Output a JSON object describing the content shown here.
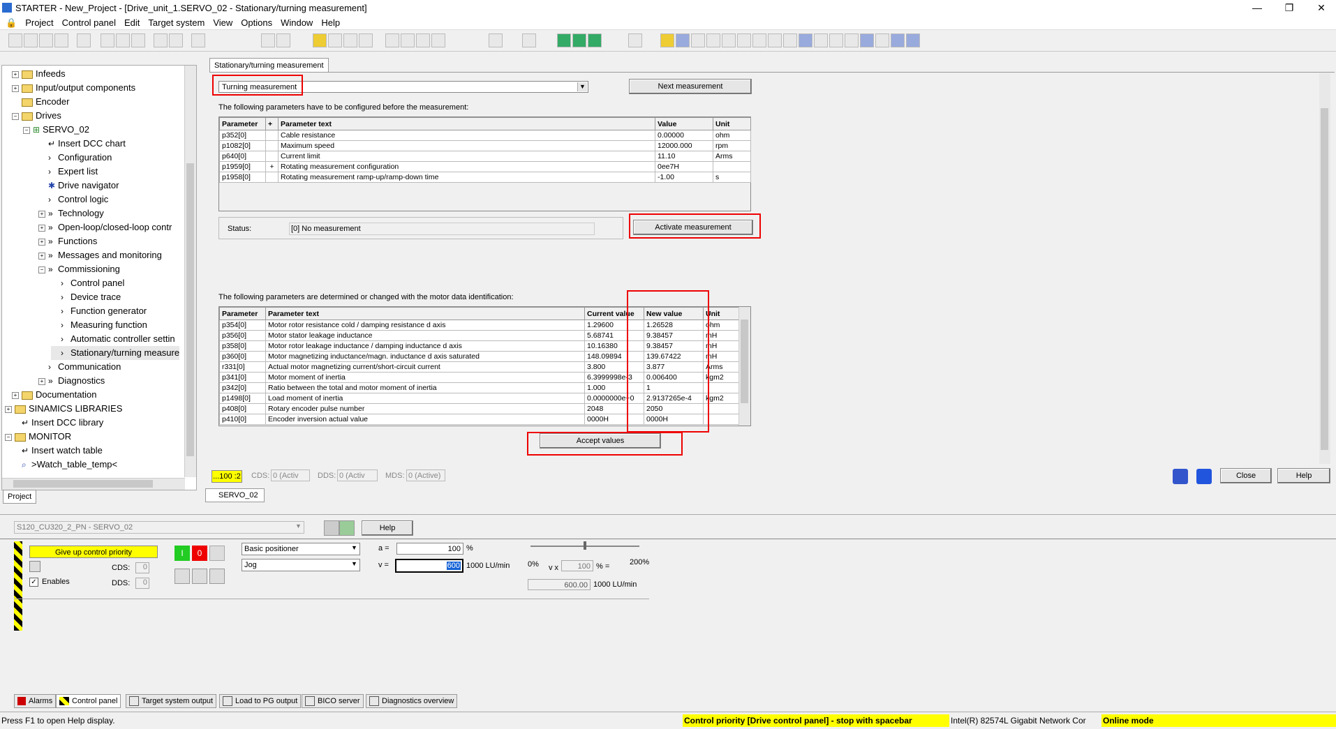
{
  "window": {
    "title": "STARTER - New_Project - [Drive_unit_1.SERVO_02 - Stationary/turning measurement]",
    "minimize": "—",
    "restore": "❐",
    "close": "✕"
  },
  "menu": [
    "Project",
    "Control panel",
    "Edit",
    "Target system",
    "View",
    "Options",
    "Window",
    "Help"
  ],
  "tree": {
    "items": [
      {
        "label": "Infeeds",
        "indent": 0,
        "type": "folder",
        "expand": "+"
      },
      {
        "label": "Input/output components",
        "indent": 0,
        "type": "folder",
        "expand": "+"
      },
      {
        "label": "Encoder",
        "indent": 0,
        "type": "folder",
        "expand": ""
      },
      {
        "label": "Drives",
        "indent": 0,
        "type": "folder",
        "expand": "-"
      },
      {
        "label": "SERVO_02",
        "indent": 1,
        "type": "drive",
        "expand": "-"
      },
      {
        "label": "Insert DCC chart",
        "indent": 2,
        "type": "item",
        "expand": ""
      },
      {
        "label": "Configuration",
        "indent": 2,
        "type": "chev",
        "expand": ""
      },
      {
        "label": "Expert list",
        "indent": 2,
        "type": "chev",
        "expand": ""
      },
      {
        "label": "Drive navigator",
        "indent": 2,
        "type": "gear",
        "expand": ""
      },
      {
        "label": "Control logic",
        "indent": 2,
        "type": "chev",
        "expand": ""
      },
      {
        "label": "Technology",
        "indent": 2,
        "type": "dchev",
        "expand": "+"
      },
      {
        "label": "Open-loop/closed-loop contr",
        "indent": 2,
        "type": "dchev",
        "expand": "+"
      },
      {
        "label": "Functions",
        "indent": 2,
        "type": "dchev",
        "expand": "+"
      },
      {
        "label": "Messages and monitoring",
        "indent": 2,
        "type": "dchev",
        "expand": "+"
      },
      {
        "label": "Commissioning",
        "indent": 2,
        "type": "dchev",
        "expand": "-"
      },
      {
        "label": "Control panel",
        "indent": 3,
        "type": "chev",
        "expand": ""
      },
      {
        "label": "Device trace",
        "indent": 3,
        "type": "chev",
        "expand": ""
      },
      {
        "label": "Function generator",
        "indent": 3,
        "type": "chev",
        "expand": ""
      },
      {
        "label": "Measuring function",
        "indent": 3,
        "type": "chev",
        "expand": ""
      },
      {
        "label": "Automatic controller settin",
        "indent": 3,
        "type": "chev",
        "expand": ""
      },
      {
        "label": "Stationary/turning measure",
        "indent": 3,
        "type": "chev",
        "expand": ""
      },
      {
        "label": "Communication",
        "indent": 2,
        "type": "chev",
        "expand": ""
      },
      {
        "label": "Diagnostics",
        "indent": 2,
        "type": "dchev",
        "expand": "+"
      },
      {
        "label": "Documentation",
        "indent": 0,
        "type": "folder",
        "expand": "+"
      },
      {
        "label": "SINAMICS LIBRARIES",
        "indent": -1,
        "type": "folder",
        "expand": "+"
      },
      {
        "label": "Insert DCC library",
        "indent": 0,
        "type": "item",
        "expand": ""
      },
      {
        "label": "MONITOR",
        "indent": -1,
        "type": "folder",
        "expand": "-"
      },
      {
        "label": "Insert watch table",
        "indent": 0,
        "type": "item",
        "expand": ""
      },
      {
        "label": ">Watch_table_temp<",
        "indent": 0,
        "type": "watch",
        "expand": ""
      }
    ],
    "tab": "Project"
  },
  "main": {
    "tab": "Stationary/turning measurement",
    "mode_select": "Turning measurement",
    "next_button": "Next measurement",
    "config_intro": "The following parameters have to be configured before the measurement:",
    "config_headers": [
      "Parameter",
      "+",
      "Parameter text",
      "Value",
      "Unit"
    ],
    "config_rows": [
      [
        "p352[0]",
        "",
        "Cable resistance",
        "0.00000",
        "ohm"
      ],
      [
        "p1082[0]",
        "",
        "Maximum speed",
        "12000.000",
        "rpm"
      ],
      [
        "p640[0]",
        "",
        "Current limit",
        "11.10",
        "Arms"
      ],
      [
        "p1959[0]",
        "+",
        "Rotating measurement configuration",
        "0ee7H",
        ""
      ],
      [
        "p1958[0]",
        "",
        "Rotating measurement ramp-up/ramp-down time",
        "-1.00",
        "s"
      ]
    ],
    "status_label": "Status:",
    "status_value": "[0] No measurement",
    "activate_button": "Activate measurement",
    "result_intro": "The following parameters are determined or changed with the motor data identification:",
    "result_headers": [
      "Parameter",
      "Parameter text",
      "Current value",
      "New value",
      "Unit"
    ],
    "result_rows": [
      [
        "p354[0]",
        "Motor rotor resistance cold / damping resistance d axis",
        "1.29600",
        "1.26528",
        "ohm"
      ],
      [
        "p356[0]",
        "Motor stator leakage inductance",
        "5.68741",
        "9.38457",
        "mH"
      ],
      [
        "p358[0]",
        "Motor rotor leakage inductance / damping inductance d axis",
        "10.16380",
        "9.38457",
        "mH"
      ],
      [
        "p360[0]",
        "Motor magnetizing inductance/magn. inductance d axis saturated",
        "148.09894",
        "139.67422",
        "mH"
      ],
      [
        "r331[0]",
        "Actual motor magnetizing current/short-circuit current",
        "3.800",
        "3.877",
        "Arms"
      ],
      [
        "p341[0]",
        "Motor moment of inertia",
        "6.3999998e-3",
        "0.006400",
        "kgm2"
      ],
      [
        "p342[0]",
        "Ratio between the total and motor moment of inertia",
        "1.000",
        "1",
        ""
      ],
      [
        "p1498[0]",
        "Load moment of inertia",
        "0.0000000e+0",
        "2.9137265e-4",
        "kgm2"
      ],
      [
        "p408[0]",
        "Rotary encoder pulse number",
        "2048",
        "2050",
        ""
      ],
      [
        "p410[0]",
        "Encoder inversion actual value",
        "0000H",
        "0000H",
        ""
      ]
    ],
    "accept_button": "Accept values",
    "cu_label": "...100 :2",
    "cds_label": "CDS:",
    "cds_value": "0 (Activ",
    "dds_label": "DDS:",
    "dds_value": "0 (Activ",
    "mds_label": "MDS:",
    "mds_value": "0 (Active)",
    "close_button": "Close",
    "help_button": "Help",
    "doc_tab": "SERVO_02"
  },
  "panel": {
    "drive_select": "S120_CU320_2_PN - SERVO_02",
    "help_button": "Help",
    "give_up_button": "Give up control priority",
    "on_button": "I",
    "off_button": "0",
    "cds_label": "CDS:",
    "cds_value": "0",
    "dds_label": "DDS:",
    "dds_value": "0",
    "enables_label": "Enables",
    "mode_select": "Basic positioner",
    "jog_select": "Jog",
    "a_label": "a =",
    "a_value": "100",
    "a_unit": "%",
    "v_label": "v =",
    "v_value": "600",
    "v_unit": "1000 LU/min",
    "slider_min": "0%",
    "slider_max": "200%",
    "vx_label": "v x",
    "vx_value": "100",
    "vx_unit": "% =",
    "result_value": "600.00",
    "result_unit": "1000 LU/min"
  },
  "bottom_tabs": [
    "Alarms",
    "Control panel",
    "Target system output",
    "Load to PG output",
    "BICO server",
    "Diagnostics overview"
  ],
  "statusbar": {
    "help": "Press F1 to open Help display.",
    "priority": "Control priority [Drive control panel] - stop with spacebar",
    "adapter": "Intel(R) 82574L Gigabit Network Cor",
    "mode": "Online mode"
  },
  "colors": {
    "highlight_red": "#e00000",
    "yellow": "#ffff00",
    "online_yellow": "#ffff00"
  }
}
